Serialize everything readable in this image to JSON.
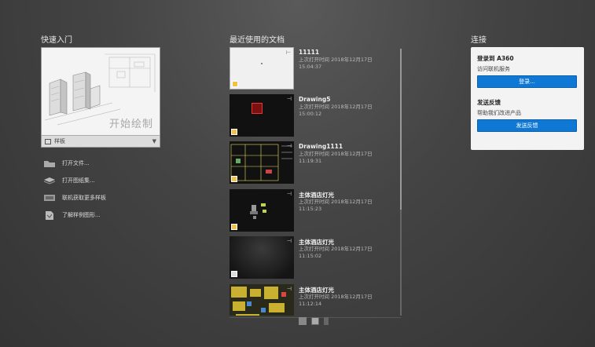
{
  "quick_start": {
    "title": "快速入门",
    "card_label": "开始绘制",
    "template_label": "样板",
    "links": [
      {
        "label": "打开文件...",
        "icon": "folder-icon"
      },
      {
        "label": "打开图纸集...",
        "icon": "sheet-set-icon"
      },
      {
        "label": "联机获取更多样板",
        "icon": "online-templates-icon"
      },
      {
        "label": "了解样例图形...",
        "icon": "sample-drawings-icon"
      }
    ]
  },
  "recent": {
    "title": "最近使用的文档",
    "items": [
      {
        "name": "11111",
        "opened_label": "上次打开时间 2018年12月17日",
        "time": "15:04:37"
      },
      {
        "name": "Drawing5",
        "opened_label": "上次打开时间 2018年12月17日",
        "time": "15:00:12"
      },
      {
        "name": "Drawing1111",
        "opened_label": "上次打开时间 2018年12月17日",
        "time": "11:19:31"
      },
      {
        "name": "主体酒店灯光",
        "opened_label": "上次打开时间 2018年12月17日",
        "time": "11:15:23"
      },
      {
        "name": "主体酒店灯光",
        "opened_label": "上次打开时间 2018年12月17日",
        "time": "11:15:02"
      },
      {
        "name": "主体酒店灯光",
        "opened_label": "上次打开时间 2018年12月17日",
        "time": "11:12:14"
      }
    ]
  },
  "connect": {
    "title": "连接",
    "signin_heading": "登录到 A360",
    "signin_sub": "访问联机服务",
    "signin_button": "登录...",
    "feedback_heading": "发送反馈",
    "feedback_sub": "帮助我们改进产品",
    "feedback_button": "发送反馈"
  },
  "colors": {
    "accent": "#0f78d4",
    "background": "#444444"
  }
}
